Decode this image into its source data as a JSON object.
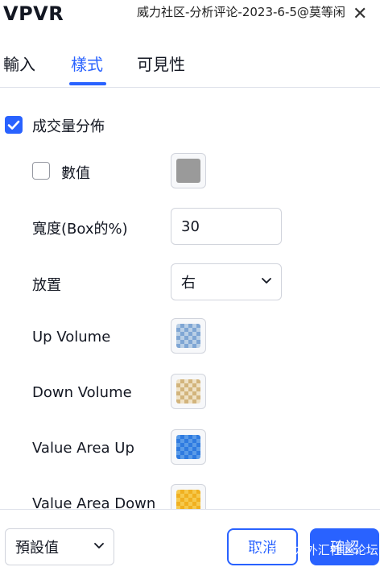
{
  "dialog": {
    "title": "VPVR",
    "watermark_top": "威力社区-分析评论-2023-6-5@莫等闲",
    "close_icon": "✕"
  },
  "tabs": [
    {
      "label": "輸入"
    },
    {
      "label": "樣式",
      "active": true
    },
    {
      "label": "可見性"
    }
  ],
  "style": {
    "volume_profile": {
      "label": "成交量分佈",
      "checked": true
    },
    "values": {
      "label": "數值",
      "checked": false,
      "color": "#9a9a9a"
    },
    "width": {
      "label": "寬度(Box的%)",
      "value": "30"
    },
    "placement": {
      "label": "放置",
      "selected": "右"
    },
    "up_volume": {
      "label": "Up Volume",
      "color": "#7fa6d4"
    },
    "down_volume": {
      "label": "Down Volume",
      "color": "#d2b47c"
    },
    "value_area_up": {
      "label": "Value Area Up",
      "color": "#2f7be0"
    },
    "value_area_down": {
      "label": "Value Area Down",
      "color": "#f0b020"
    }
  },
  "footer": {
    "defaults_label": "預設值",
    "cancel_label": "取消",
    "ok_label": "確認",
    "watermark_bottom": "知乎 @威力外汇社区论坛"
  },
  "colors": {
    "accent": "#2962ff",
    "border": "#d1d4dc",
    "text": "#131722"
  }
}
